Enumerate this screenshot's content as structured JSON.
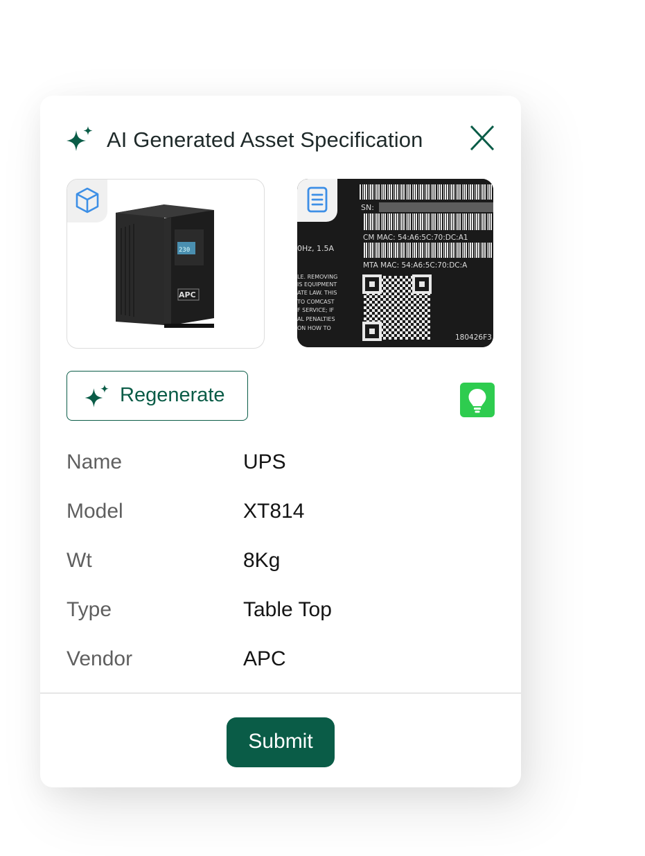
{
  "header": {
    "title": "AI Generated Asset Specification",
    "icon": "sparkle-icon",
    "close_icon": "close-icon"
  },
  "images": {
    "product": {
      "badge_icon": "cube-icon",
      "brand_text": "APC",
      "display_text": "230"
    },
    "label": {
      "badge_icon": "document-icon",
      "sn_label": "SN:",
      "cm_mac": "CM MAC: 54:A6:5C:70:DC:A1",
      "rating": "0Hz, 1.5A",
      "mta_mac": "MTA MAC: 54:A6:5C:70:DC:A",
      "warning_lines": [
        "LE. REMOVING",
        "IS EQUIPMENT",
        "ATE LAW. THIS",
        "TO COMCAST",
        "F SERVICE; IF",
        "AL PENALTIES",
        "ON HOW TO"
      ],
      "code": "180426F3"
    }
  },
  "actions": {
    "regenerate_label": "Regenerate",
    "regenerate_icon": "sparkle-icon",
    "tip_icon": "lightbulb-icon",
    "submit_label": "Submit"
  },
  "specs": [
    {
      "key": "Name",
      "value": "UPS"
    },
    {
      "key": "Model",
      "value": "XT814"
    },
    {
      "key": "Wt",
      "value": "8Kg"
    },
    {
      "key": "Type",
      "value": "Table Top"
    },
    {
      "key": "Vendor",
      "value": "APC"
    }
  ],
  "colors": {
    "brand": "#0a5c47",
    "accent_blue": "#3d8fe6",
    "bulb_green": "#2ecc4f"
  }
}
